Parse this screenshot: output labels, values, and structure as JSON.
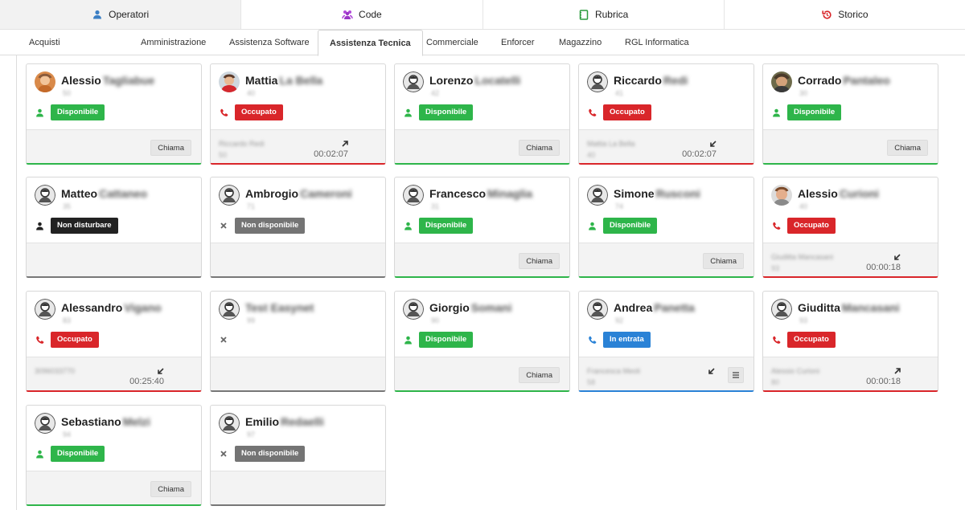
{
  "nav": [
    {
      "label": "Operatori",
      "icon": "user-icon",
      "active": true
    },
    {
      "label": "Code",
      "icon": "users-icon",
      "active": false
    },
    {
      "label": "Rubrica",
      "icon": "address-book-icon",
      "active": false
    },
    {
      "label": "Storico",
      "icon": "history-icon",
      "active": false
    }
  ],
  "tabs": [
    {
      "label": "Acquisti",
      "active": false
    },
    {
      "label": "Amministrazione",
      "active": false
    },
    {
      "label": "Assistenza Software",
      "active": false
    },
    {
      "label": "Assistenza Tecnica",
      "active": true
    },
    {
      "label": "Commerciale",
      "active": false
    },
    {
      "label": "Enforcer",
      "active": false
    },
    {
      "label": "Magazzino",
      "active": false
    },
    {
      "label": "RGL Informatica",
      "active": false
    }
  ],
  "call_label": "Chiama",
  "operators": [
    {
      "name": "Alessio",
      "surname": "Tagliabue",
      "ext": "50",
      "status": "Disponibile",
      "state": "available",
      "avatar": "photo-orange"
    },
    {
      "name": "Mattia",
      "surname": "La Bella",
      "ext": "40",
      "status": "Occupato",
      "state": "busy",
      "avatar": "photo-red",
      "peer": "Riccardo Redi",
      "peer_ext": "50",
      "direction": "out",
      "duration": "00:02:07"
    },
    {
      "name": "Lorenzo",
      "surname": "Locatelli",
      "ext": "42",
      "status": "Disponibile",
      "state": "available",
      "avatar": "default"
    },
    {
      "name": "Riccardo",
      "surname": "Redi",
      "ext": "41",
      "status": "Occupato",
      "state": "busy",
      "avatar": "default",
      "peer": "Mattia La Bella",
      "peer_ext": "40",
      "direction": "in",
      "duration": "00:02:07"
    },
    {
      "name": "Corrado",
      "surname": "Pantaleo",
      "ext": "30",
      "status": "Disponibile",
      "state": "available",
      "avatar": "photo-brown"
    },
    {
      "name": "Matteo",
      "surname": "Cattaneo",
      "ext": "35",
      "status": "Non disturbare",
      "state": "dnd",
      "avatar": "default"
    },
    {
      "name": "Ambrogio",
      "surname": "Cameroni",
      "ext": "71",
      "status": "Non disponibile",
      "state": "offline",
      "avatar": "default"
    },
    {
      "name": "Francesco",
      "surname": "Minaglia",
      "ext": "31",
      "status": "Disponibile",
      "state": "available",
      "avatar": "default"
    },
    {
      "name": "Simone",
      "surname": "Rusconi",
      "ext": "74",
      "status": "Disponibile",
      "state": "available",
      "avatar": "default"
    },
    {
      "name": "Alessio",
      "surname": "Curioni",
      "ext": "40",
      "status": "Occupato",
      "state": "busy",
      "avatar": "photo-face",
      "peer": "Giuditta Mancasani",
      "peer_ext": "93",
      "direction": "in",
      "duration": "00:00:18"
    },
    {
      "name": "Alessandro",
      "surname": "Vigano",
      "ext": "83",
      "status": "Occupato",
      "state": "busy",
      "avatar": "default",
      "peer": "3096033770",
      "peer_ext": "",
      "direction": "in",
      "duration": "00:25:40"
    },
    {
      "name": "",
      "surname": "Test Easynet",
      "ext": "99",
      "status": "",
      "state": "offline-noname",
      "avatar": "default"
    },
    {
      "name": "Giorgio",
      "surname": "Somani",
      "ext": "90",
      "status": "Disponibile",
      "state": "available",
      "avatar": "default"
    },
    {
      "name": "Andrea",
      "surname": "Panetta",
      "ext": "92",
      "status": "In entrata",
      "state": "incoming",
      "avatar": "default",
      "peer": "Francesca Meoli",
      "peer_ext": "58",
      "direction": "in",
      "duration": ""
    },
    {
      "name": "Giuditta",
      "surname": "Mancasani",
      "ext": "93",
      "status": "Occupato",
      "state": "busy",
      "avatar": "default",
      "peer": "Alessio Curioni",
      "peer_ext": "80",
      "direction": "out",
      "duration": "00:00:18"
    },
    {
      "name": "Sebastiano",
      "surname": "Melzi",
      "ext": "94",
      "status": "Disponibile",
      "state": "available",
      "avatar": "default"
    },
    {
      "name": "Emilio",
      "surname": "Redaelli",
      "ext": "97",
      "status": "Non disponibile",
      "state": "offline",
      "avatar": "default"
    }
  ]
}
